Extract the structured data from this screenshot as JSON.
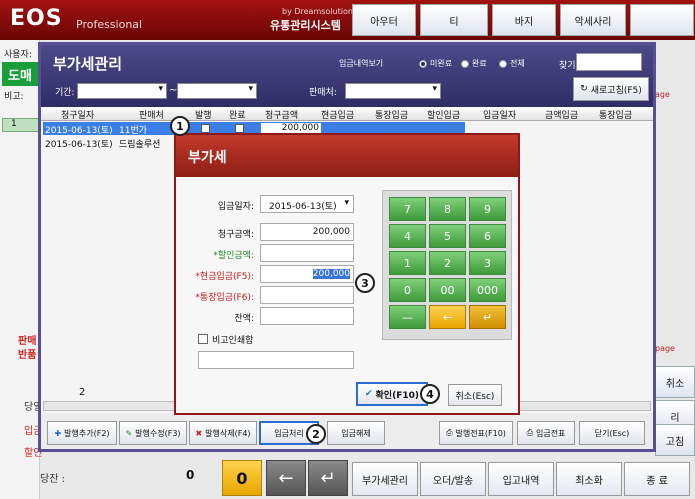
{
  "app": {
    "logo": "EOS",
    "logo_sub": "Professional",
    "brand_small": "by Dreamsolution",
    "brand_main": "유통관리시스템"
  },
  "left": {
    "user_label": "사용자:",
    "green_btn": "도매",
    "memo_label": "비고:",
    "row_no": "1",
    "side_red1": "판매",
    "side_red2": "반품",
    "item_a": "당일",
    "item_b": "입금",
    "item_c": "할인",
    "balance_label": "당잔 :",
    "balance_value": "0"
  },
  "top_buttons": [
    "아우터",
    "티",
    "바지",
    "악세사리"
  ],
  "right_side": {
    "page_a": "age",
    "page_b": "page",
    "btn_a": "취소",
    "btn_b": "리",
    "btn_c": "고침"
  },
  "bottom_bar": {
    "zero_key": "0",
    "back_key": "←",
    "enter_key": "↵",
    "buttons": [
      "부가세관리",
      "오더/발송",
      "입고내역",
      "최소화",
      "종 료"
    ]
  },
  "vat_window": {
    "title": "부가세관리",
    "view_deposit": "입금내역보기",
    "radio_unpaid": "미완료",
    "radio_done": "완료",
    "radio_all": "전체",
    "search_label": "찾기:",
    "period_label": "기간:",
    "tilde": "~",
    "seller_label": "판매처:",
    "refresh": "새로고침(F5)",
    "columns": [
      "청구일자",
      "판매처",
      "발행",
      "완료",
      "청구금액",
      "현금입금",
      "통장입금",
      "할인입금",
      "입금일자",
      "금액입금",
      "통장입금"
    ],
    "rows": [
      {
        "date": "2015-06-13(토)",
        "seller": "11번가",
        "amount": "200,000"
      },
      {
        "date": "2015-06-13(토)",
        "seller": "드림솔루션",
        "amount": ""
      }
    ],
    "row_count": "2",
    "footer_buttons": [
      "발행추가(F2)",
      "발행수정(F3)",
      "발행삭제(F4)",
      "입금처리",
      "입금해제",
      "발행전표(F10)",
      "입금전표",
      "닫기(Esc)"
    ]
  },
  "dialog": {
    "title": "부가세",
    "deposit_date_label": "입금일자:",
    "deposit_date": "2015-06-13(토)",
    "claim_label": "청구금액:",
    "claim_value": "200,000",
    "discount_label": "*할인금액:",
    "cash_label": "*현금입금(F5):",
    "cash_value": "200,000",
    "bank_label": "*통장입금(F6):",
    "balance_label": "잔액:",
    "memo_label": "비고인쇄함",
    "ok": "확인(F10)",
    "cancel": "취소(Esc)",
    "keys": [
      "7",
      "8",
      "9",
      "4",
      "5",
      "6",
      "1",
      "2",
      "3",
      "0",
      "00",
      "000",
      "—",
      "←",
      "↵"
    ]
  },
  "annotations": [
    "1",
    "2",
    "3",
    "4"
  ],
  "colors": {
    "topbar": "#a31212",
    "window_header": "#3c3978",
    "dialog_header": "#b03226",
    "keypad_green": "#4ea84a",
    "selection": "#3b7fe6"
  }
}
